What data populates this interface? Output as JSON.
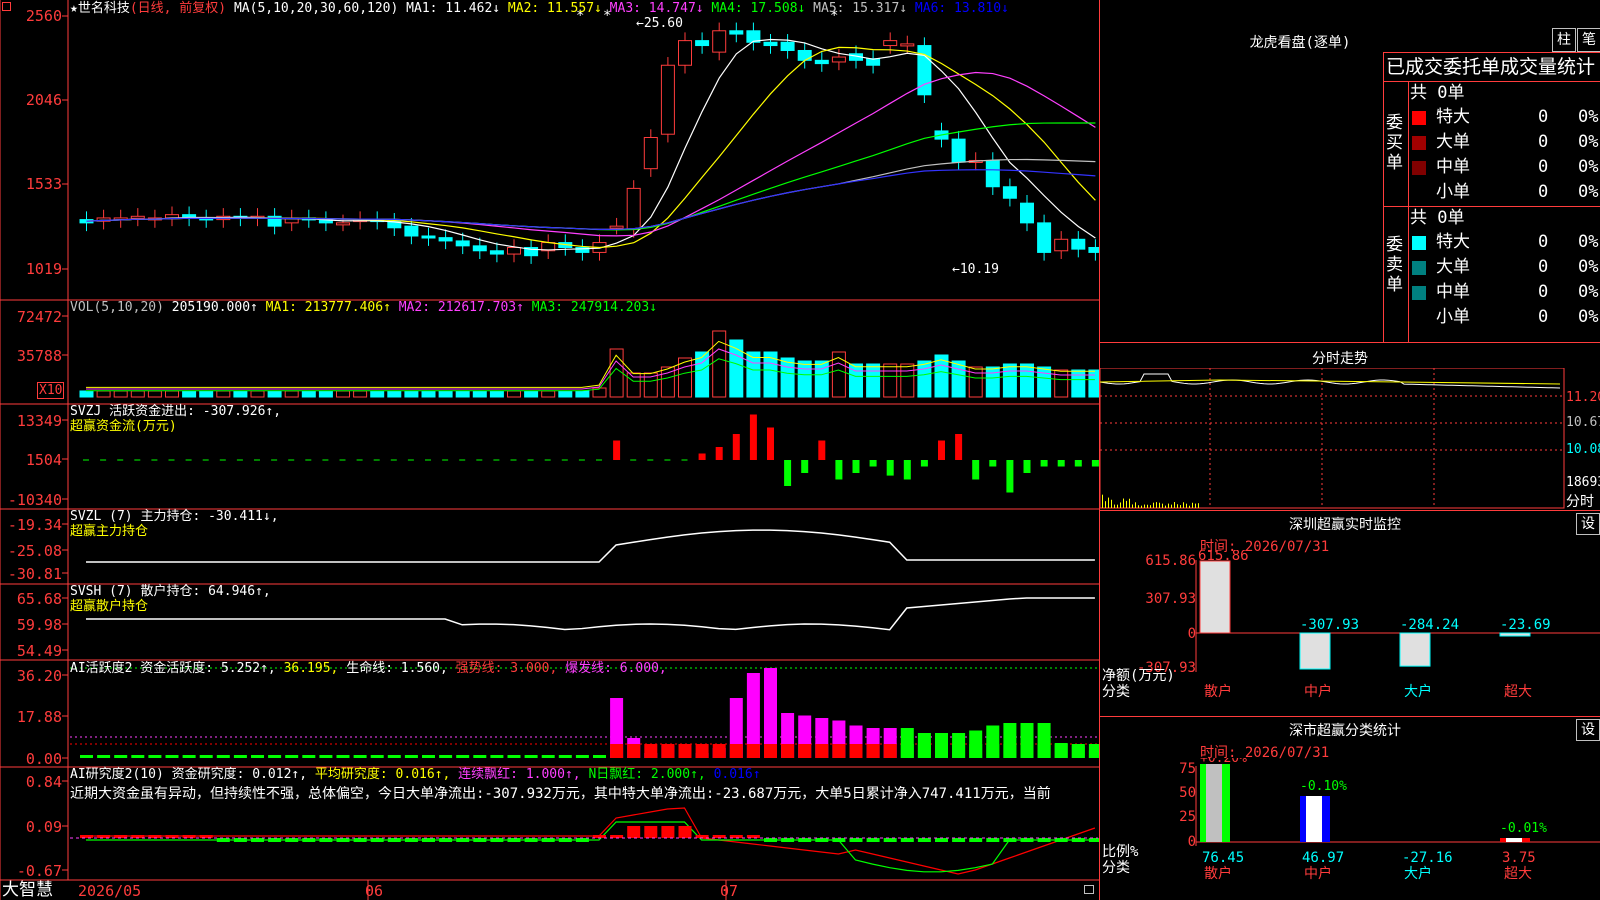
{
  "main": {
    "title": "★世名科技",
    "subtitle": "(日线, 前复权)",
    "ma_label": "MA(5,10,20,30,60,120)",
    "ma1": "MA1: 11.462↓",
    "ma2": "MA2: 11.557↓",
    "ma3": "MA3: 14.747↓",
    "ma4": "MA4: 17.508↓",
    "ma5": "MA5: 15.317↓",
    "ma6": "MA6: 13.810↓",
    "y_labels": [
      "2560",
      "2046",
      "1533",
      "1019"
    ],
    "high_mark": "←25.60",
    "low_mark": "←10.19"
  },
  "vol": {
    "label": "VOL(5,10,20)",
    "value": "205190.000↑",
    "ma1": "MA1: 213777.406↑",
    "ma2": "MA2: 212617.703↑",
    "ma3": "MA3: 247914.203↓",
    "y_labels": [
      "72472",
      "35788"
    ],
    "unit": "X10"
  },
  "svzj": {
    "label": "SVZJ  活跃资金进出: -307.926↑,",
    "sub": "超赢资金流(万元)",
    "y_labels": [
      "13349",
      "1504",
      "-10340"
    ]
  },
  "svzl": {
    "label": "SVZL (7) 主力持仓: -30.411↓,",
    "sub": "超赢主力持仓",
    "y_labels": [
      "-19.34",
      "-25.08",
      "-30.81"
    ]
  },
  "svsh": {
    "label": "SVSH (7) 散户持仓: 64.946↑,",
    "sub": "超赢散户持仓",
    "y_labels": [
      "65.68",
      "59.98",
      "54.49"
    ]
  },
  "ai1": {
    "label": "AI活跃度2 资金活跃度: 5.252↑,",
    "v2": "36.195,",
    "v3": "生命线: 1.560,",
    "v4": "强势线: 3.000,",
    "v5": "爆发线: 6.000,",
    "y_labels": [
      "36.20",
      "17.88",
      "0.00"
    ]
  },
  "ai2": {
    "label": "AI研究度2(10) 资金研究度: 0.012↑,",
    "v2": "平均研究度: 0.016↑,",
    "v3": "连续飘红: 1.000↑,",
    "v4": "N日飘红: 2.000↑,",
    "v5": "0.016↑",
    "note": "近期大资金虽有异动，但持续性不强，总体偏空，今日大单净流出:-307.932万元，其中特大单净流出:-23.687万元，大单5日累计净入747.411万元，当前",
    "y_labels": [
      "0.84",
      "0.09",
      "-0.67"
    ]
  },
  "xaxis": {
    "brand": "大智慧",
    "labels": [
      "2026/05",
      "06",
      "07"
    ]
  },
  "right": {
    "lhb_title": "龙虎看盘(逐单)",
    "btn_bar": "柱",
    "btn_pen": "笔",
    "stats_title": "已成交委托单成交量统计",
    "buy": {
      "side": "委买单",
      "total": "共 0单",
      "rows": [
        {
          "name": "特大",
          "count": "0",
          "pct": "0%",
          "color": "#ff0000"
        },
        {
          "name": "大单",
          "count": "0",
          "pct": "0%",
          "color": "#a00000"
        },
        {
          "name": "中单",
          "count": "0",
          "pct": "0%",
          "color": "#800000"
        },
        {
          "name": "小单",
          "count": "0",
          "pct": "0%",
          "color": ""
        }
      ]
    },
    "sell": {
      "side": "委卖单",
      "total": "共 0单",
      "rows": [
        {
          "name": "特大",
          "count": "0",
          "pct": "0%",
          "color": "#00ffff"
        },
        {
          "name": "大单",
          "count": "0",
          "pct": "0%",
          "color": "#008080"
        },
        {
          "name": "中单",
          "count": "0",
          "pct": "0%",
          "color": "#008080"
        },
        {
          "name": "小单",
          "count": "0",
          "pct": "0%",
          "color": ""
        }
      ]
    },
    "intraday_title": "分时走势",
    "intraday_labels": [
      "11.20",
      "10.67",
      "10.08",
      "18693",
      "分时"
    ],
    "sz_title": "深圳超赢实时监控",
    "set_btn": "设",
    "sz_time": "时间: 2026/07/31",
    "sz_y": [
      "615.86",
      "307.93",
      "0",
      "-307.93"
    ],
    "sz_values": [
      "615.86",
      "-307.93",
      "-284.24",
      "-23.69"
    ],
    "sz_ylabel": "净额(万元)",
    "sz_xlabel": "分类",
    "cats": [
      "散户",
      "中户",
      "大户",
      "超大"
    ],
    "cls_title": "深市超赢分类统计",
    "cls_time": "时间: 2026/07/31",
    "cls_y": [
      "75",
      "50",
      "25",
      "0"
    ],
    "cls_pcts": [
      "+0.20%",
      "-0.10%",
      "-0.01%"
    ],
    "cls_values": [
      "76.45",
      "46.97",
      "-27.16",
      "3.75"
    ],
    "cls_ylabel": "比例%",
    "cls_xlabel": "分类"
  },
  "colors": {
    "up": "#ff3c3c",
    "down": "#00ffff",
    "grid": "#b00000"
  }
}
